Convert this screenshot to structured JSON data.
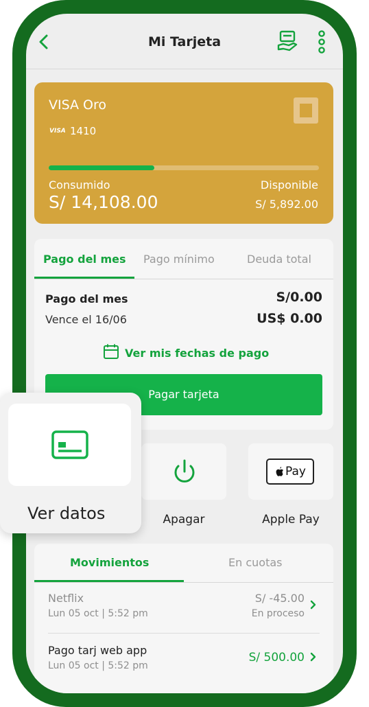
{
  "header": {
    "title": "Mi Tarjeta"
  },
  "card": {
    "name": "VISA Oro",
    "brand_mark": "VISA",
    "last_digits": "1410",
    "consumed_label": "Consumido",
    "consumed_amount": "S/ 14,108.00",
    "available_label": "Disponible",
    "available_amount": "S/ 5,892.00",
    "usage_fraction": 0.39,
    "color": "#d4a43c"
  },
  "payment": {
    "tabs": [
      "Pago del mes",
      "Pago mínimo",
      "Deuda total"
    ],
    "active_tab": 0,
    "label": "Pago del mes",
    "due": "Vence el 16/06",
    "amount_pen": "S/0.00",
    "amount_usd": "US$ 0.00",
    "dates_link": "Ver mis fechas de pago",
    "pay_button": "Pagar tarjeta"
  },
  "actions": {
    "items": [
      {
        "label": "Ver datos",
        "icon": "card-details-icon"
      },
      {
        "label": "Apagar",
        "icon": "power-icon"
      },
      {
        "label": "Apple Pay",
        "icon": "apple-pay-icon"
      }
    ],
    "apple_pay_badge": "Pay"
  },
  "movements": {
    "tabs": [
      "Movimientos",
      "En cuotas"
    ],
    "active_tab": 0,
    "rows": [
      {
        "title": "Netflix",
        "date": "Lun 05 oct | 5:52 pm",
        "amount": "S/ -45.00",
        "status": "En proceso"
      },
      {
        "title": "Pago tarj web app",
        "date": "Lun 05 oct | 5:52 pm",
        "amount": "S/ 500.00",
        "status": ""
      }
    ]
  },
  "colors": {
    "frame": "#146b1f",
    "accent": "#14a33d",
    "button": "#15b24a",
    "card_gold": "#d4a43c"
  }
}
